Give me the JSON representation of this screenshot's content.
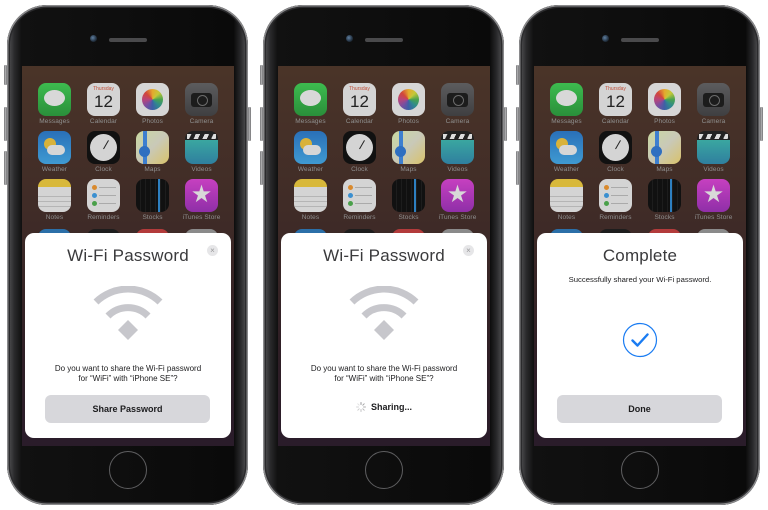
{
  "home_screen": {
    "apps": [
      {
        "label": "Messages",
        "icon": "messages-icon",
        "style": "ic-messages"
      },
      {
        "label": "Calendar",
        "icon": "calendar-icon",
        "style": "ic-calendar",
        "weekday": "Thursday",
        "date": "12"
      },
      {
        "label": "Photos",
        "icon": "photos-icon",
        "style": "ic-photos"
      },
      {
        "label": "Camera",
        "icon": "camera-icon",
        "style": "ic-camera"
      },
      {
        "label": "Weather",
        "icon": "weather-icon",
        "style": "ic-weather"
      },
      {
        "label": "Clock",
        "icon": "clock-icon",
        "style": "ic-clock"
      },
      {
        "label": "Maps",
        "icon": "maps-icon",
        "style": "ic-maps"
      },
      {
        "label": "Videos",
        "icon": "videos-icon",
        "style": "ic-videos"
      },
      {
        "label": "Notes",
        "icon": "notes-icon",
        "style": "ic-notes"
      },
      {
        "label": "Reminders",
        "icon": "reminders-icon",
        "style": "ic-reminders"
      },
      {
        "label": "Stocks",
        "icon": "stocks-icon",
        "style": "ic-stocks"
      },
      {
        "label": "iTunes Store",
        "icon": "itunes-store-icon",
        "style": "ic-itunes",
        "glyph": "★"
      }
    ]
  },
  "screens": [
    {
      "state": "prompt",
      "title": "Wi-Fi Password",
      "close_glyph": "×",
      "message_line1": "Do you want to share the Wi-Fi password",
      "message_line2": "for “WiFi” with “iPhone SE”?",
      "button_label": "Share Password"
    },
    {
      "state": "sharing",
      "title": "Wi-Fi Password",
      "close_glyph": "×",
      "message_line1": "Do you want to share the Wi-Fi password",
      "message_line2": "for “WiFi” with “iPhone SE”?",
      "status_label": "Sharing..."
    },
    {
      "state": "complete",
      "title": "Complete",
      "subtitle": "Successfully shared your Wi-Fi password.",
      "button_label": "Done"
    }
  ],
  "colors": {
    "accent": "#1a7cf2",
    "button_bg": "#d7d7db",
    "wifi_glyph": "#c7c7cc"
  }
}
